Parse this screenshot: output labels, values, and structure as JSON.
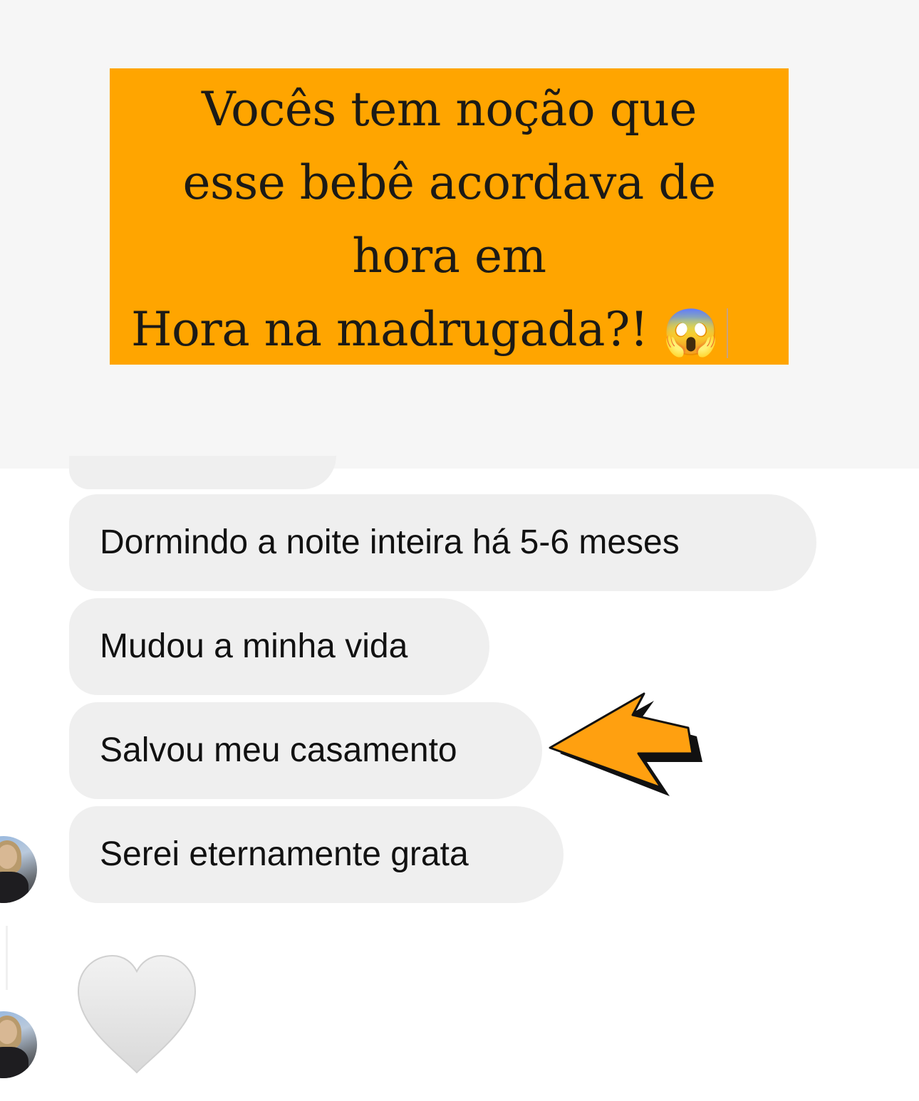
{
  "caption": {
    "lines": [
      "Vocês tem noção que",
      "esse bebê acordava de",
      "hora em",
      "Hora na madrugada?!"
    ],
    "emoji": "😱",
    "background_color": "#ffa500",
    "text_color": "#1c1a16"
  },
  "messages": [
    {
      "text": "Dormindo a noite inteira há 5-6 meses"
    },
    {
      "text": "Mudou a minha vida"
    },
    {
      "text": "Salvou meu casamento"
    },
    {
      "text": "Serei eternamente grata"
    }
  ],
  "reaction": {
    "emoji": "white-heart",
    "color": "#e4e4e4"
  },
  "annotation": {
    "icon": "arrow-pointer-icon",
    "color": "#ffa010"
  },
  "bubble_color": "#efefef"
}
